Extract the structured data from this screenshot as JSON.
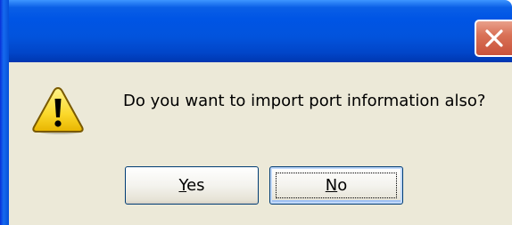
{
  "dialog": {
    "message": "Do you want to import port information also?",
    "icon": "warning-icon",
    "close_icon": "close-icon",
    "buttons": [
      {
        "accel": "Y",
        "rest": "es",
        "label": "Yes"
      },
      {
        "accel": "N",
        "rest": "o",
        "label": "No"
      }
    ],
    "focused_button": "No",
    "colors": {
      "titlebar": "#0055e5",
      "client_bg": "#ece9d8",
      "close_button": "#d97257",
      "button_border": "#003c74"
    }
  }
}
